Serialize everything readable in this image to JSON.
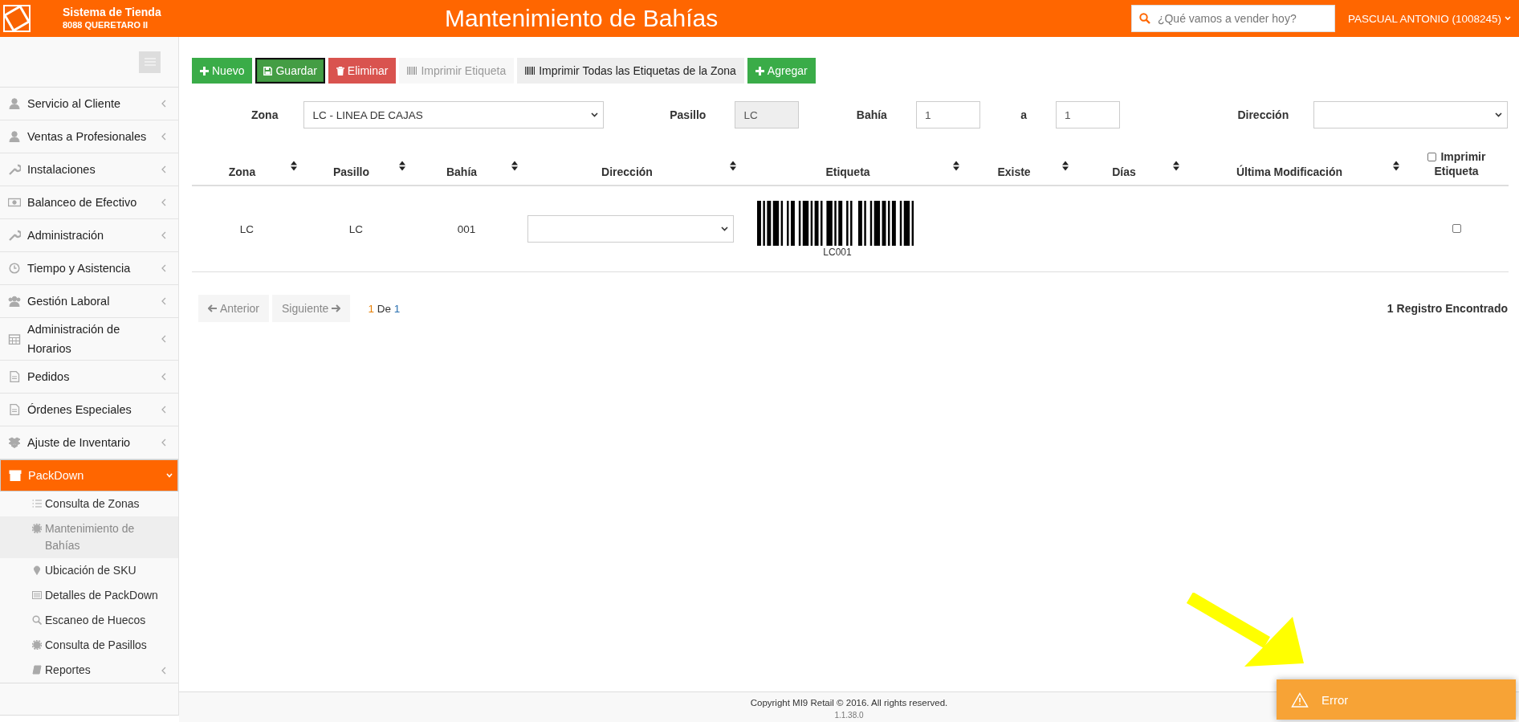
{
  "header": {
    "brand": "Sistema de Tienda",
    "store": "8088 QUERETARO II",
    "title": "Mantenimiento de Bahías",
    "search": {
      "placeholder": "¿Qué vamos a vender hoy?"
    },
    "user": "PASCUAL ANTONIO (1008245)"
  },
  "sidebar": {
    "items": [
      {
        "label": "Servicio al Cliente",
        "selected": false,
        "expanded": false
      },
      {
        "label": "Ventas a Profesionales",
        "selected": false,
        "expanded": false
      },
      {
        "label": "Instalaciones",
        "selected": false,
        "expanded": false
      },
      {
        "label": "Balanceo de Efectivo",
        "selected": false,
        "expanded": false
      },
      {
        "label": "Administración",
        "selected": false,
        "expanded": false
      },
      {
        "label": "Tiempo y Asistencia",
        "selected": false,
        "expanded": false
      },
      {
        "label": "Gestión Laboral",
        "selected": false,
        "expanded": false
      },
      {
        "label": "Administración de Horarios",
        "selected": false,
        "expanded": false
      },
      {
        "label": "Pedidos",
        "selected": false,
        "expanded": false
      },
      {
        "label": "Órdenes Especiales",
        "selected": false,
        "expanded": false
      },
      {
        "label": "Ajuste de Inventario",
        "selected": false,
        "expanded": false
      },
      {
        "label": "PackDown",
        "selected": true,
        "expanded": true,
        "children": [
          {
            "label": "Consulta de Zonas",
            "selected": false,
            "has_submenu": false
          },
          {
            "label": "Mantenimiento de Bahías",
            "selected": true,
            "has_submenu": false
          },
          {
            "label": "Ubicación de SKU",
            "selected": false,
            "has_submenu": false
          },
          {
            "label": "Detalles de PackDown",
            "selected": false,
            "has_submenu": false
          },
          {
            "label": "Escaneo de Huecos",
            "selected": false,
            "has_submenu": false
          },
          {
            "label": "Consulta de Pasillos",
            "selected": false,
            "has_submenu": false
          },
          {
            "label": "Reportes",
            "selected": false,
            "has_submenu": true
          }
        ]
      }
    ]
  },
  "toolbar": [
    {
      "label": "Nuevo",
      "kind": "new",
      "disabled": false,
      "focused": false
    },
    {
      "label": "Guardar",
      "kind": "save",
      "disabled": false,
      "focused": true
    },
    {
      "label": "Eliminar",
      "kind": "delete",
      "disabled": false,
      "focused": false
    },
    {
      "label": "Imprimir Etiqueta",
      "kind": "print",
      "disabled": true,
      "focused": false
    },
    {
      "label": "Imprimir Todas las Etiquetas de la Zona",
      "kind": "print",
      "disabled": false,
      "focused": false
    },
    {
      "label": "Agregar",
      "kind": "new",
      "disabled": false,
      "focused": false
    }
  ],
  "form": {
    "zona": {
      "label": "Zona",
      "value": "LC - LINEA DE CAJAS"
    },
    "pasillo": {
      "label": "Pasillo",
      "value": "LC"
    },
    "bahia": {
      "label": "Bahía",
      "value": "1"
    },
    "a": {
      "label": "a",
      "value": "1"
    },
    "direccion": {
      "label": "Dirección"
    }
  },
  "table": {
    "columns": [
      {
        "label": "Zona",
        "kind": "sortable"
      },
      {
        "label": "Pasillo",
        "kind": "sortable"
      },
      {
        "label": "Bahía",
        "kind": "sortable"
      },
      {
        "label": "Dirección",
        "kind": "sortable"
      },
      {
        "label": "Etiqueta",
        "kind": "sortable"
      },
      {
        "label": "Existe",
        "kind": "sortable"
      },
      {
        "label": "Días",
        "kind": "sortable"
      },
      {
        "label": "Última Modificación",
        "kind": "sortable"
      },
      {
        "label": "Imprimir Etiqueta",
        "kind": "checkbox",
        "checked": false
      }
    ],
    "rows": [
      {
        "zona": "LC",
        "pasillo": "LC",
        "bahia": "001",
        "etiqueta": "LC001",
        "imprimir": false
      }
    ]
  },
  "pagination": {
    "previous": "Anterior",
    "next": "Siguiente",
    "page": "1",
    "of": "De",
    "total": "1",
    "count": "1 Registro Encontrado"
  },
  "footer": {
    "copyright": "Copyright MI9 Retail © 2016. All rights reserved.",
    "version": "1.1.38.0"
  },
  "toast": {
    "message": "Error"
  }
}
